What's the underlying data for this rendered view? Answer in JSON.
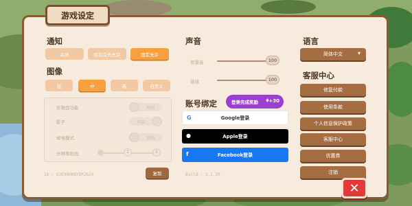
{
  "title": "游戏设定",
  "notify": {
    "heading": "通知",
    "options": [
      "关闭",
      "仅在白天允许",
      "固定允许"
    ],
    "selected": 2
  },
  "graphics": {
    "heading": "图像",
    "options": [
      "低",
      "中",
      "高",
      "自定义"
    ],
    "selected": 1,
    "settings": [
      {
        "label": "反锯齿功能",
        "state": "关闭"
      },
      {
        "label": "影子",
        "state": "开启"
      },
      {
        "label": "省电模式",
        "state": "关闭"
      }
    ],
    "resolution": {
      "label": "分辨率阶段",
      "marks": [
        "2",
        "3"
      ]
    }
  },
  "footer": {
    "id_text": "ID : DJE96HNBYDPZ6Z4",
    "copy_label": "复制",
    "build_text": "Build : 1.1.10"
  },
  "sound": {
    "heading": "声音",
    "bgm": {
      "label": "背景音",
      "value": "100"
    },
    "sfx": {
      "label": "音效",
      "value": "100"
    }
  },
  "account": {
    "heading": "账号绑定",
    "reward_label": "登录完成奖励",
    "reward_amount": "+30",
    "google": "Google登录",
    "apple": "Apple登录",
    "facebook": "Facebook登录"
  },
  "language": {
    "heading": "语言",
    "selected": "简体中文"
  },
  "support": {
    "heading": "客服中心",
    "buttons": [
      "修复付款",
      "使用条款",
      "个人信息保护政策",
      "客服中心",
      "优惠券",
      "注销"
    ]
  },
  "colors": {
    "accent_orange": "#f7a040",
    "brown": "#a56d42",
    "close_red": "#e23a3a",
    "reward_purple": "#9b3fd1",
    "facebook_blue": "#1877f2"
  },
  "icons": {
    "close": "close-x-icon",
    "google": "google-g-icon",
    "apple": "apple-icon",
    "facebook": "facebook-f-icon",
    "dropdown": "chevron-down-icon",
    "reward": "diamond-icon"
  }
}
